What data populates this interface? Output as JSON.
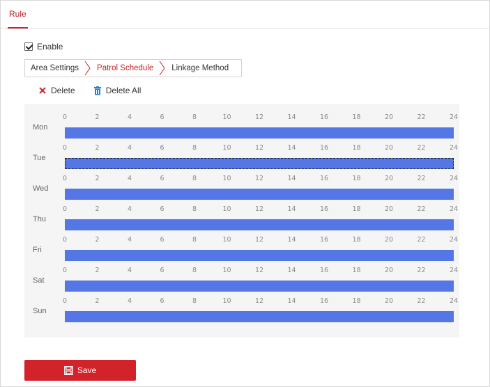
{
  "header": {
    "tab_label": "Rule"
  },
  "enable": {
    "label": "Enable",
    "checked": true
  },
  "subtabs": {
    "area_settings": "Area Settings",
    "patrol_schedule": "Patrol Schedule",
    "linkage_method": "Linkage Method"
  },
  "toolbar": {
    "delete_label": "Delete",
    "delete_all_label": "Delete All"
  },
  "schedule": {
    "hour_ticks": [
      "0",
      "2",
      "4",
      "6",
      "8",
      "10",
      "12",
      "14",
      "16",
      "18",
      "20",
      "22",
      "24"
    ],
    "days": [
      {
        "label": "Mon",
        "start": 0,
        "end": 24,
        "selected": false
      },
      {
        "label": "Tue",
        "start": 0,
        "end": 24,
        "selected": true
      },
      {
        "label": "Wed",
        "start": 0,
        "end": 24,
        "selected": false
      },
      {
        "label": "Thu",
        "start": 0,
        "end": 24,
        "selected": false
      },
      {
        "label": "Fri",
        "start": 0,
        "end": 24,
        "selected": false
      },
      {
        "label": "Sat",
        "start": 0,
        "end": 24,
        "selected": false
      },
      {
        "label": "Sun",
        "start": 0,
        "end": 24,
        "selected": false
      }
    ],
    "bar_color": "#5577e6"
  },
  "save": {
    "label": "Save"
  },
  "colors": {
    "accent": "#c8232a"
  }
}
